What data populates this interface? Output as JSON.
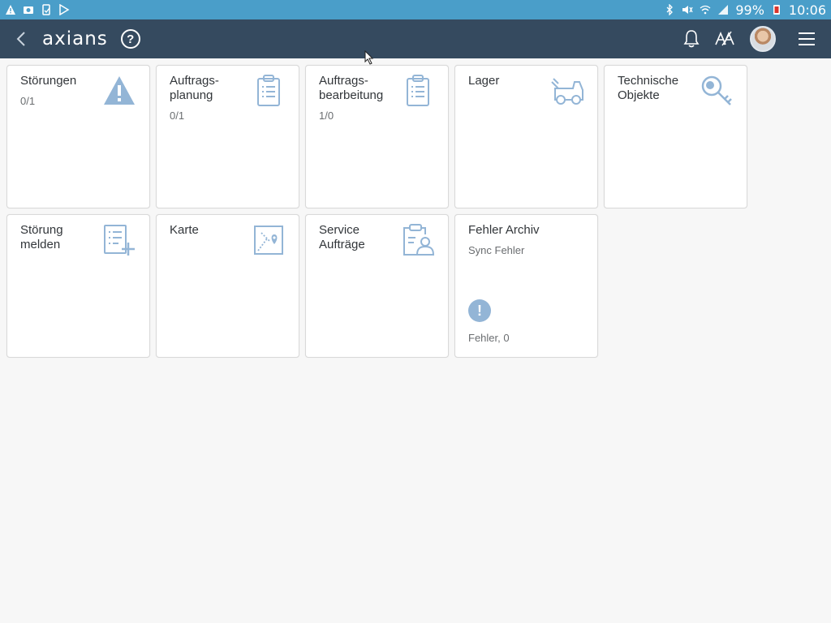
{
  "statusbar": {
    "battery": "99%",
    "time": "10:06"
  },
  "header": {
    "logo": "axians",
    "help_label": "?"
  },
  "colors": {
    "statusbar": "#4a9ec9",
    "header": "#354a5f",
    "tile_icon": "#93b5d6",
    "background": "#f7f7f7"
  },
  "tiles": [
    {
      "title": "Störungen",
      "sub": "0/1",
      "icon": "warning-icon"
    },
    {
      "title": "Auftrags-\nplanung",
      "sub": "0/1",
      "icon": "clipboard-icon"
    },
    {
      "title": "Auftrags-\nbearbeitung",
      "sub": "1/0",
      "icon": "clipboard-icon"
    },
    {
      "title": "Lager",
      "sub": "",
      "icon": "forklift-icon"
    },
    {
      "title": "Technische\nObjekte",
      "sub": "",
      "icon": "key-search-icon"
    },
    {
      "title": "Störung\nmelden",
      "sub": "",
      "icon": "list-add-icon"
    },
    {
      "title": "Karte",
      "sub": "",
      "icon": "map-icon"
    },
    {
      "title": "Service\nAufträge",
      "sub": "",
      "icon": "clipboard-person-icon"
    },
    {
      "title": "Fehler Archiv",
      "sub": "Sync Fehler",
      "icon": "exclamation-icon",
      "footer": "Fehler, 0",
      "badge": "!"
    }
  ]
}
